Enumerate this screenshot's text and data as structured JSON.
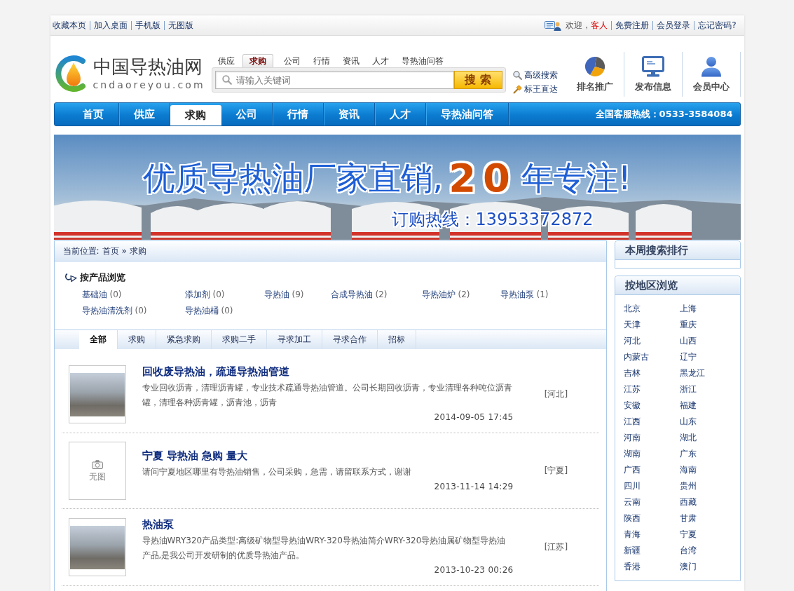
{
  "top_bar": {
    "links": [
      "收藏本页",
      "加入桌面",
      "手机版",
      "无图版"
    ],
    "greeting": "欢迎，",
    "user": "客人",
    "account_links": [
      "免费注册",
      "会员登录",
      "忘记密码?"
    ]
  },
  "header": {
    "logo": {
      "name": "中国导热油网",
      "domain": "cndaoreyou.com"
    },
    "search": {
      "tabs": [
        {
          "label": "供应",
          "selected": false
        },
        {
          "label": "求购",
          "selected": true
        },
        {
          "label": "公司",
          "selected": false
        },
        {
          "label": "行情",
          "selected": false
        },
        {
          "label": "资讯",
          "selected": false
        },
        {
          "label": "人才",
          "selected": false
        },
        {
          "label": "导热油问答",
          "selected": false
        }
      ],
      "placeholder": "请输入关键词",
      "button": "搜索"
    },
    "links": [
      {
        "kind": "search",
        "label": "高级搜索"
      },
      {
        "kind": "hammer",
        "label": "标王直达"
      }
    ],
    "shortcuts": [
      {
        "kind": "chart",
        "label": "排名推广"
      },
      {
        "kind": "monitor",
        "label": "发布信息"
      },
      {
        "kind": "user",
        "label": "会员中心"
      }
    ]
  },
  "nav": {
    "items": [
      {
        "label": "首页",
        "selected": false
      },
      {
        "label": "供应",
        "selected": false
      },
      {
        "label": "求购",
        "selected": true
      },
      {
        "label": "公司",
        "selected": false
      },
      {
        "label": "行情",
        "selected": false
      },
      {
        "label": "资讯",
        "selected": false
      },
      {
        "label": "人才",
        "selected": false
      },
      {
        "label": "导热油问答",
        "selected": false
      }
    ],
    "hotline": "全国客服热线：0533-3584084"
  },
  "banner": {
    "slogan": "优质导热油厂家直销,",
    "years": "20",
    "slogan_end": "年专注!",
    "hotline": "订购热线：13953372872"
  },
  "breadcrumb": {
    "label": "当前位置:",
    "items": [
      "首页",
      "求购"
    ],
    "separator": "»"
  },
  "categories": {
    "title": "按产品浏览",
    "items": [
      {
        "name": "基础油",
        "count": "(0)"
      },
      {
        "name": "添加剂",
        "count": "(0)"
      },
      {
        "name": "导热油",
        "count": "(9)"
      },
      {
        "name": "合成导热油",
        "count": "(2)"
      },
      {
        "name": "导热油炉",
        "count": "(2)"
      },
      {
        "name": "导热油泵",
        "count": "(1)"
      },
      {
        "name": "导热油清洗剂",
        "count": "(0)"
      },
      {
        "name": "导热油桶",
        "count": "(0)"
      }
    ]
  },
  "filter_tabs": [
    {
      "label": "全部",
      "selected": true
    },
    {
      "label": "求购",
      "selected": false
    },
    {
      "label": "紧急求购",
      "selected": false
    },
    {
      "label": "求购二手",
      "selected": false
    },
    {
      "label": "寻求加工",
      "selected": false
    },
    {
      "label": "寻求合作",
      "selected": false
    },
    {
      "label": "招标",
      "selected": false
    }
  ],
  "listings": [
    {
      "title": "回收废导热油，疏通导热油管道",
      "description": "专业回收沥青，清理沥青罐，专业技术疏通导热油管道。公司长期回收沥青，专业清理各种吨位沥青罐，清理各种沥青罐，沥青池，沥青",
      "date": "2014-09-05 17:45",
      "region": "[河北]",
      "thumbnail": {
        "kind": "photo"
      }
    },
    {
      "title": "宁夏 导热油 急购 量大",
      "description": "请问宁夏地区哪里有导热油销售，公司采购，急需，请留联系方式，谢谢",
      "date": "2013-11-14 14:29",
      "region": "[宁夏]",
      "thumbnail": {
        "kind": "none",
        "label": "无图"
      }
    },
    {
      "title": "热油泵",
      "description": "导热油WRY320产品类型:高级矿物型导热油WRY-320导热油简介WRY-320导热油属矿物型导热油产品,是我公司开发研制的优质导热油产品。",
      "date": "2013-10-23 00:26",
      "region": "[江苏]",
      "thumbnail": {
        "kind": "photo"
      }
    }
  ],
  "sidebar": [
    {
      "kind": "ranking",
      "title": "本周搜索排行"
    },
    {
      "kind": "regions",
      "title": "按地区浏览",
      "items": [
        "北京",
        "上海",
        "天津",
        "重庆",
        "河北",
        "山西",
        "内蒙古",
        "辽宁",
        "吉林",
        "黑龙江",
        "江苏",
        "浙江",
        "安徽",
        "福建",
        "江西",
        "山东",
        "河南",
        "湖北",
        "湖南",
        "广东",
        "广西",
        "海南",
        "四川",
        "贵州",
        "云南",
        "西藏",
        "陕西",
        "甘肃",
        "青海",
        "宁夏",
        "新疆",
        "台湾",
        "香港",
        "澳门"
      ]
    }
  ]
}
